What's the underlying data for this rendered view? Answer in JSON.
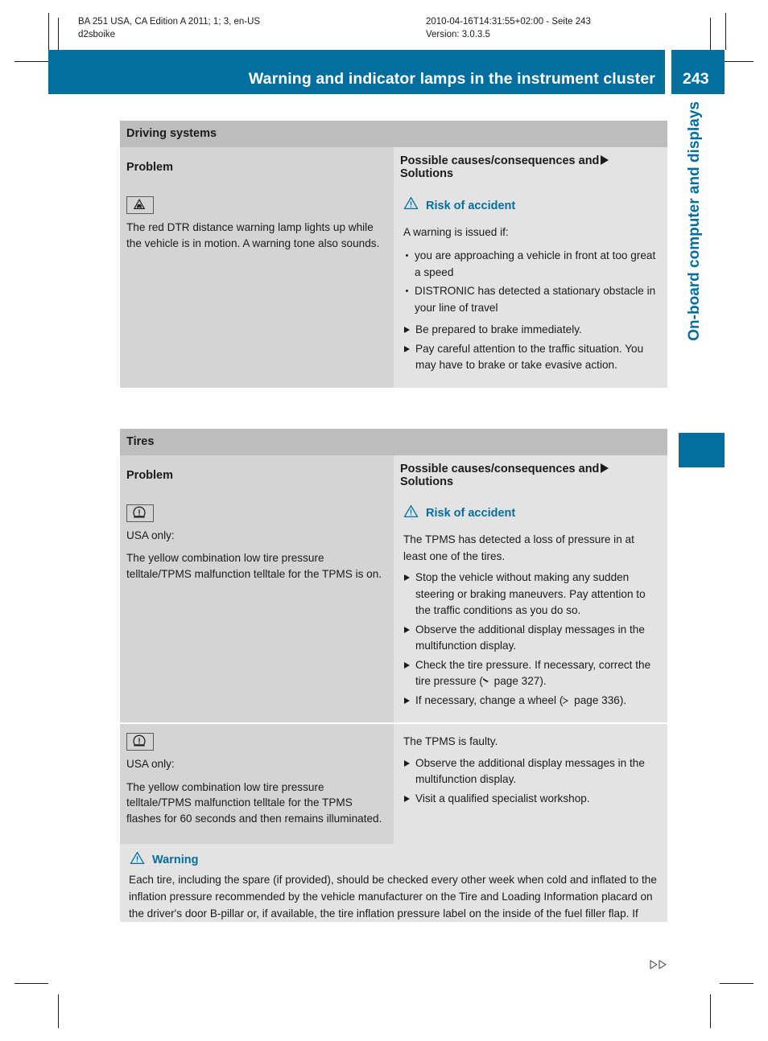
{
  "meta": {
    "header_left_line1": "BA 251 USA, CA Edition A 2011; 1; 3, en-US",
    "header_left_line2": "d2sboike",
    "header_right_line1": "2010-04-16T14:31:55+02:00 - Seite 243",
    "header_right_line2": "Version: 3.0.3.5"
  },
  "header": {
    "title": "Warning and indicator lamps in the instrument cluster",
    "page_number": "243"
  },
  "sidebar": {
    "chapter_label": "On-board computer and displays"
  },
  "colors": {
    "brand_blue": "#046e9f",
    "section_header_gray": "#bdbdbd",
    "column_header_gray": "#d4d4d4",
    "problem_cell_gray": "#d4d4d4",
    "solution_cell_gray": "#e3e3e3",
    "text_black": "#1b1b1b"
  },
  "tables": [
    {
      "section_title": "Driving systems",
      "columns": {
        "problem": "Problem",
        "solutions_prefix": "Possible causes/consequences and",
        "solutions_suffix": "Solutions"
      },
      "rows": [
        {
          "icon": "dtr-distance-warning-lamp-icon",
          "problem_text": "The red DTR distance warning lamp lights up while the vehicle is in motion. A warning tone also sounds.",
          "warning_heading": "Risk of accident",
          "lead": "A warning is issued if:",
          "bullets": [
            "you are approaching a vehicle in front at too great a speed",
            "DISTRONIC has detected a stationary obstacle in your line of travel"
          ],
          "actions": [
            "Be prepared to brake immediately.",
            "Pay careful attention to the traffic situation. You may have to brake or take evasive action."
          ]
        }
      ]
    },
    {
      "section_title": "Tires",
      "columns": {
        "problem": "Problem",
        "solutions_prefix": "Possible causes/consequences and",
        "solutions_suffix": "Solutions"
      },
      "rows": [
        {
          "icon": "tire-pressure-telltale-icon",
          "problem_prefix": "USA only:",
          "problem_text": "The yellow combination low tire pressure telltale/TPMS malfunction telltale for the TPMS is on.",
          "warning_heading": "Risk of accident",
          "lead": "The TPMS has detected a loss of pressure in at least one of the tires.",
          "bullets": [],
          "actions": [
            "Stop the vehicle without making any sudden steering or braking maneuvers. Pay attention to the traffic conditions as you do so.",
            "Observe the additional display messages in the multifunction display.",
            "Check the tire pressure. If necessary, correct the tire pressure (▷ page 327).",
            "If necessary, change a wheel (▷ page 336)."
          ],
          "actions_refs": [
            null,
            null,
            "327",
            "336"
          ]
        },
        {
          "icon": "tire-pressure-telltale-icon",
          "problem_prefix": "USA only:",
          "problem_text": "The yellow combination low tire pressure telltale/TPMS malfunction telltale for the TPMS flashes for 60 seconds and then remains illuminated.",
          "warning_heading": null,
          "lead": "The TPMS is faulty.",
          "bullets": [],
          "actions": [
            "Observe the additional display messages in the multifunction display.",
            "Visit a qualified specialist workshop."
          ]
        }
      ]
    }
  ],
  "warning_box": {
    "heading": "Warning",
    "body": "Each tire, including the spare (if provided), should be checked every other week when cold and inflated to the inflation pressure recommended by the vehicle manufacturer on the Tire and Loading Information placard on the driver's door B-pillar or, if available, the tire inflation pressure label on the inside of the fuel filler flap. If your vehicle has tires of a different size than the size"
  },
  "footer": {
    "continue_marker": "continue-icon"
  }
}
